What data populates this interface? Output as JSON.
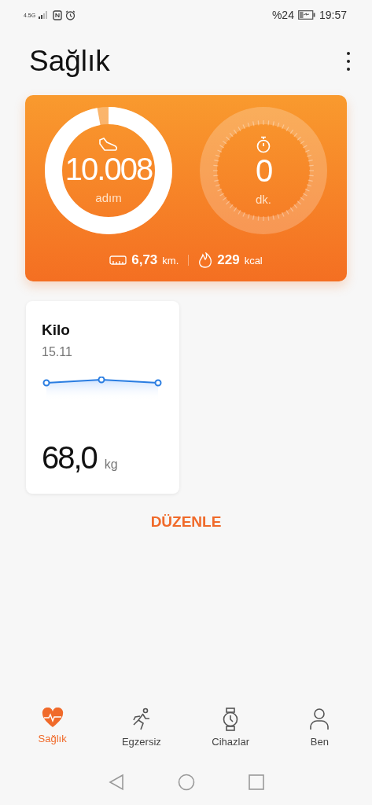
{
  "status_bar": {
    "network": "4.5G",
    "battery": "%24",
    "time": "19:57"
  },
  "header": {
    "title": "Sağlık"
  },
  "activity": {
    "steps": {
      "value": "10.008",
      "unit": "adım"
    },
    "minutes": {
      "value": "0",
      "unit": "dk."
    },
    "distance": {
      "value": "6,73",
      "unit": "km."
    },
    "calories": {
      "value": "229",
      "unit": "kcal"
    }
  },
  "weight_card": {
    "title": "Kilo",
    "date": "15.11",
    "value": "68,0",
    "unit": "kg"
  },
  "edit_button": "DÜZENLE",
  "tabs": [
    {
      "label": "Sağlık",
      "kind": "heart",
      "selected": true
    },
    {
      "label": "Egzersiz",
      "kind": "run",
      "selected": false
    },
    {
      "label": "Cihazlar",
      "kind": "watch",
      "selected": false
    },
    {
      "label": "Ben",
      "kind": "person",
      "selected": false
    }
  ]
}
